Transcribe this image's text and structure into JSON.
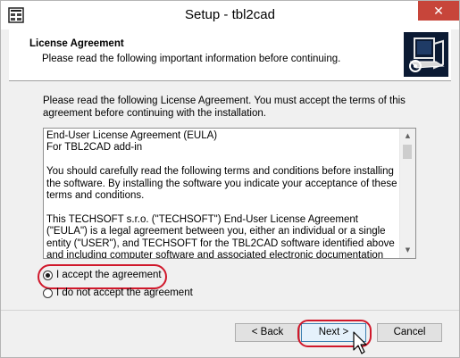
{
  "window": {
    "title": "Setup - tbl2cad",
    "close_glyph": "✕",
    "app_icon": "installer-grid-icon"
  },
  "header": {
    "title": "License Agreement",
    "subtitle": "Please read the following important information before continuing.",
    "logo_icon": "setup-computer-logo-icon"
  },
  "main": {
    "intro": "Please read the following License Agreement. You must accept the terms of this agreement before continuing with the installation.",
    "license_lines": [
      "End-User License Agreement (EULA)",
      "For TBL2CAD add-in",
      "You should carefully read the following terms and conditions before installing the software. By installing the software you indicate your acceptance of these terms and conditions.",
      "This TECHSOFT s.r.o.  (\"TECHSOFT\") End-User License Agreement (\"EULA\") is a legal agreement between you, either an individual or a single entity (\"USER\"), and TECHSOFT for the TBL2CAD software identified above and including computer software and associated electronic documentation (\"SOFTWARE\") contained in"
    ],
    "accept_label": "I accept the agreement",
    "decline_label": "I do not accept the agreement",
    "accept_selected": true
  },
  "footer": {
    "back_label": "< Back",
    "next_label": "Next >",
    "cancel_label": "Cancel"
  },
  "colors": {
    "highlight": "#d0182b",
    "close": "#c7453a",
    "logo_bg": "#0b1a33"
  }
}
